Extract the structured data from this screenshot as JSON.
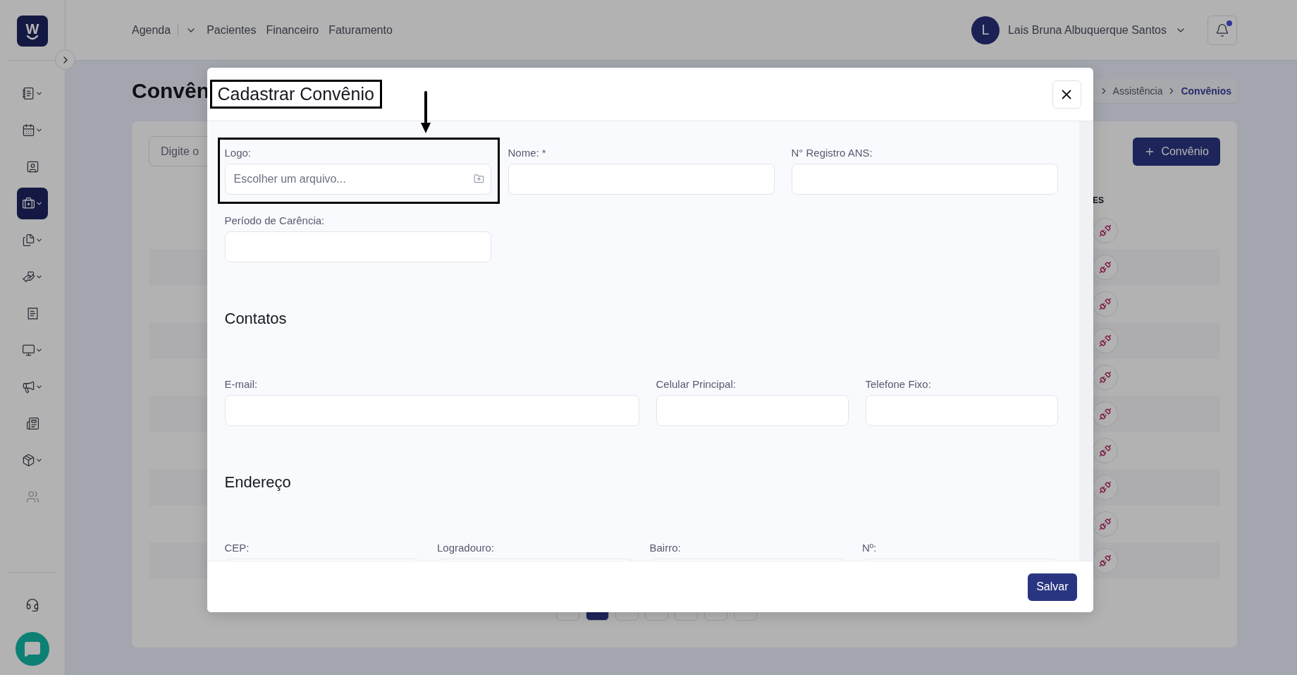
{
  "sidebar": {
    "logo": {
      "letter": "W"
    },
    "items": [
      {
        "selected": false,
        "dropdown": true,
        "disabled": false
      },
      {
        "selected": false,
        "dropdown": true,
        "disabled": false
      },
      {
        "selected": false,
        "dropdown": false,
        "disabled": false
      },
      {
        "selected": true,
        "dropdown": true,
        "disabled": false
      },
      {
        "selected": false,
        "dropdown": true,
        "disabled": false
      },
      {
        "selected": false,
        "dropdown": true,
        "disabled": false
      },
      {
        "selected": false,
        "dropdown": false,
        "disabled": false
      },
      {
        "selected": false,
        "dropdown": true,
        "disabled": false
      },
      {
        "selected": false,
        "dropdown": true,
        "disabled": false
      },
      {
        "selected": false,
        "dropdown": false,
        "disabled": false
      },
      {
        "selected": false,
        "dropdown": true,
        "disabled": false
      },
      {
        "selected": false,
        "dropdown": false,
        "disabled": true
      }
    ]
  },
  "nav": [
    {
      "label": "Agenda",
      "dropdown": true
    },
    {
      "label": "Pacientes",
      "dropdown": false
    },
    {
      "label": "Financeiro",
      "dropdown": false
    },
    {
      "label": "Faturamento",
      "dropdown": false
    }
  ],
  "user": {
    "initial": "L",
    "name": "Lais Bruna Albuquerque Santos"
  },
  "notifications": {
    "unread": true
  },
  "page": {
    "title": "Convên",
    "breadcrumb": [
      {
        "label": "Assistência",
        "current": false
      },
      {
        "label": "Convênios",
        "current": true
      }
    ]
  },
  "search": {
    "placeholder": "Digite o"
  },
  "add_button": {
    "label": "Convênio"
  },
  "table": {
    "column": "ES",
    "rows": [
      {
        "kind": "deactivate"
      },
      {
        "kind": "deactivate"
      },
      {
        "kind": "deactivate"
      },
      {
        "kind": "deactivate"
      },
      {
        "kind": "deactivate"
      },
      {
        "kind": "deactivate"
      },
      {
        "kind": "deactivate"
      },
      {
        "kind": "deactivate"
      },
      {
        "kind": "deactivate"
      },
      {
        "kind": "deactivate"
      }
    ]
  },
  "pagination": [
    {
      "selected": false
    },
    {
      "selected": true
    },
    {
      "selected": false
    },
    {
      "selected": false
    },
    {
      "selected": false
    },
    {
      "selected": false
    },
    {
      "selected": false
    }
  ],
  "modal": {
    "title": "Cadastrar Convênio",
    "title_outlined": true,
    "pointer_arrow": true,
    "sections": [
      {
        "rows": [
          {
            "kind": "thirds",
            "fields": [
              {
                "label": "Logo:",
                "kind": "file",
                "placeholder": "Escolher um arquivo...",
                "outlined": true
              },
              {
                "label": "Nome: *",
                "kind": "text",
                "outlined": false
              },
              {
                "label": "N° Registro ANS:",
                "kind": "text",
                "outlined": false
              }
            ]
          },
          {
            "kind": "thirds",
            "fields": [
              {
                "label": "Período de Carência:",
                "kind": "text",
                "outlined": false
              }
            ]
          }
        ]
      },
      {
        "heading": "Contatos",
        "rows": [
          {
            "kind": "wide-first",
            "fields": [
              {
                "label": "E-mail:",
                "kind": "text",
                "outlined": false
              },
              {
                "label": "Celular Principal:",
                "kind": "text",
                "outlined": false
              },
              {
                "label": "Telefone Fixo:",
                "kind": "text",
                "outlined": false
              }
            ]
          }
        ]
      },
      {
        "heading": "Endereço",
        "rows": [
          {
            "kind": "quarters",
            "fields": [
              {
                "label": "CEP:",
                "kind": "text",
                "outlined": false
              },
              {
                "label": "Logradouro:",
                "kind": "text",
                "outlined": false
              },
              {
                "label": "Bairro:",
                "kind": "text",
                "outlined": false
              },
              {
                "label": "Nº:",
                "kind": "text",
                "outlined": false
              }
            ]
          }
        ]
      }
    ],
    "save_button": "Salvar"
  }
}
